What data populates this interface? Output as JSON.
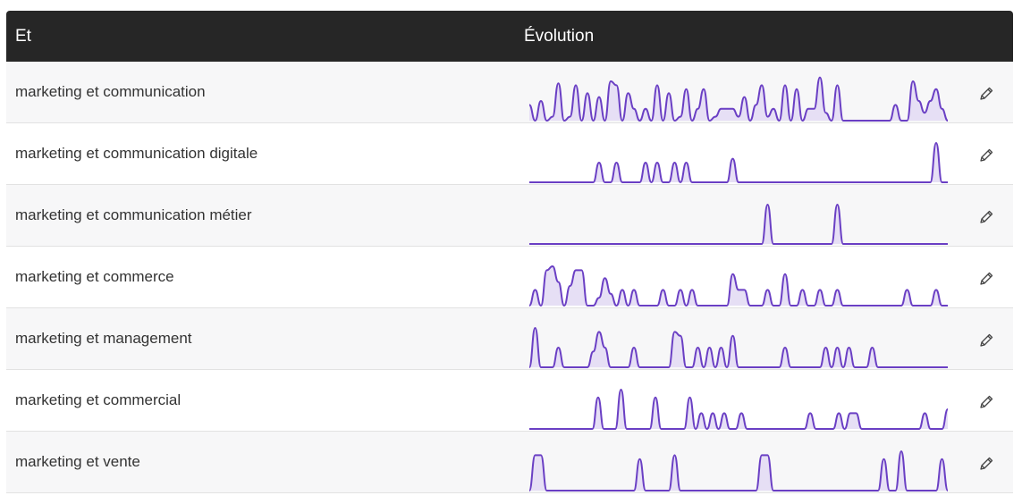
{
  "table": {
    "columns": {
      "term": "Et",
      "evolution": "Évolution"
    },
    "colors": {
      "header_bg": "#262626",
      "spark_line": "#6a3fc4",
      "spark_fill": "#e6dff5"
    },
    "rows": [
      {
        "label": "marketing et communication",
        "edit_icon": "pencil-icon",
        "trend": [
          0.4,
          0,
          0.5,
          0,
          0.1,
          0.95,
          0,
          0.1,
          0.9,
          0,
          0.7,
          0,
          0.6,
          0,
          1.0,
          0.9,
          0,
          0.7,
          0.3,
          0,
          0.3,
          0,
          0.9,
          0,
          0.7,
          0,
          0.1,
          0.8,
          0,
          0.3,
          0.8,
          0,
          0.1,
          0.3,
          0.3,
          0.3,
          0.1,
          0.6,
          0,
          0.4,
          0.9,
          0.1,
          0.3,
          0,
          0.9,
          0,
          0.8,
          0,
          0.3,
          0.3,
          1.1,
          0.2,
          0,
          0.9,
          0,
          0,
          0,
          0,
          0,
          0,
          0,
          0,
          0,
          0.4,
          0,
          0,
          1.0,
          0.5,
          0.2,
          0.5,
          0.8,
          0.3,
          0
        ]
      },
      {
        "label": "marketing et communication digitale",
        "edit_icon": "pencil-icon",
        "trend": [
          0,
          0,
          0,
          0,
          0,
          0,
          0,
          0,
          0,
          0,
          0,
          0,
          0.5,
          0,
          0,
          0.5,
          0,
          0,
          0,
          0,
          0.5,
          0,
          0.5,
          0,
          0,
          0.5,
          0,
          0.5,
          0,
          0,
          0,
          0,
          0,
          0,
          0,
          0.6,
          0,
          0,
          0,
          0,
          0,
          0,
          0,
          0,
          0,
          0,
          0,
          0,
          0,
          0,
          0,
          0,
          0,
          0,
          0,
          0,
          0,
          0,
          0,
          0,
          0,
          0,
          0,
          0,
          0,
          0,
          0,
          0,
          0,
          0,
          1.0,
          0,
          0
        ]
      },
      {
        "label": "marketing et communication métier",
        "edit_icon": "pencil-icon",
        "trend": [
          0,
          0,
          0,
          0,
          0,
          0,
          0,
          0,
          0,
          0,
          0,
          0,
          0,
          0,
          0,
          0,
          0,
          0,
          0,
          0,
          0,
          0,
          0,
          0,
          0,
          0,
          0,
          0,
          0,
          0,
          0,
          0,
          0,
          0,
          0,
          0,
          0,
          0,
          0,
          0,
          0,
          1.0,
          0,
          0,
          0,
          0,
          0,
          0,
          0,
          0,
          0,
          0,
          0,
          1.0,
          0,
          0,
          0,
          0,
          0,
          0,
          0,
          0,
          0,
          0,
          0,
          0,
          0,
          0,
          0,
          0,
          0,
          0,
          0
        ]
      },
      {
        "label": "marketing et commerce",
        "edit_icon": "pencil-icon",
        "trend": [
          0,
          0.4,
          0,
          0.9,
          1.0,
          0.6,
          0,
          0.5,
          0.9,
          0.9,
          0,
          0,
          0.2,
          0.7,
          0.3,
          0,
          0.4,
          0,
          0.4,
          0,
          0,
          0,
          0,
          0.4,
          0,
          0,
          0.4,
          0,
          0.4,
          0,
          0,
          0,
          0,
          0,
          0,
          0.8,
          0.4,
          0.4,
          0,
          0,
          0,
          0.4,
          0,
          0,
          0.8,
          0,
          0,
          0.4,
          0,
          0,
          0.4,
          0,
          0,
          0.4,
          0,
          0,
          0,
          0,
          0,
          0,
          0,
          0,
          0,
          0,
          0,
          0.4,
          0,
          0,
          0,
          0,
          0.4,
          0,
          0
        ]
      },
      {
        "label": "marketing et management",
        "edit_icon": "pencil-icon",
        "trend": [
          0,
          1.0,
          0,
          0,
          0,
          0.5,
          0,
          0,
          0,
          0,
          0,
          0.4,
          0.9,
          0.5,
          0,
          0,
          0,
          0,
          0.5,
          0,
          0,
          0,
          0,
          0,
          0,
          0.9,
          0.8,
          0,
          0,
          0.5,
          0,
          0.5,
          0,
          0.5,
          0,
          0.8,
          0,
          0,
          0,
          0,
          0,
          0,
          0,
          0,
          0.5,
          0,
          0,
          0,
          0,
          0,
          0,
          0.5,
          0,
          0.5,
          0,
          0.5,
          0,
          0,
          0,
          0.5,
          0,
          0,
          0,
          0,
          0,
          0,
          0,
          0,
          0,
          0,
          0,
          0,
          0
        ]
      },
      {
        "label": "marketing et commercial",
        "edit_icon": "pencil-icon",
        "trend": [
          0,
          0,
          0,
          0,
          0,
          0,
          0,
          0,
          0,
          0,
          0,
          0,
          0.8,
          0,
          0,
          0,
          1.0,
          0,
          0,
          0,
          0,
          0,
          0.8,
          0,
          0,
          0,
          0,
          0,
          0.8,
          0,
          0.4,
          0,
          0.4,
          0,
          0.4,
          0,
          0,
          0.4,
          0,
          0,
          0,
          0,
          0,
          0,
          0,
          0,
          0,
          0,
          0,
          0.4,
          0,
          0,
          0,
          0,
          0.4,
          0,
          0.4,
          0.4,
          0,
          0,
          0,
          0,
          0,
          0,
          0,
          0,
          0,
          0,
          0,
          0.4,
          0,
          0,
          0,
          0.5
        ]
      },
      {
        "label": "marketing et vente",
        "edit_icon": "pencil-icon",
        "trend": [
          0,
          0.9,
          0.9,
          0,
          0,
          0,
          0,
          0,
          0,
          0,
          0,
          0,
          0,
          0,
          0,
          0,
          0,
          0,
          0,
          0.8,
          0,
          0,
          0,
          0,
          0,
          0.9,
          0,
          0,
          0,
          0,
          0,
          0,
          0,
          0,
          0,
          0,
          0,
          0,
          0,
          0,
          0.9,
          0.9,
          0,
          0,
          0,
          0,
          0,
          0,
          0,
          0,
          0,
          0,
          0,
          0,
          0,
          0,
          0,
          0,
          0,
          0,
          0,
          0.8,
          0,
          0,
          1.0,
          0,
          0,
          0,
          0,
          0,
          0,
          0.8,
          0
        ]
      }
    ]
  }
}
